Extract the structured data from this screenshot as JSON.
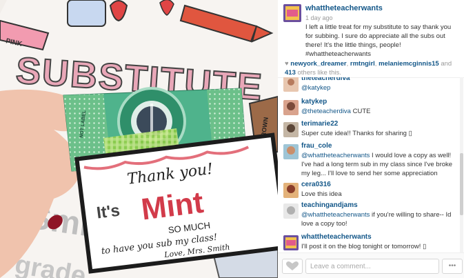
{
  "post": {
    "username": "whattheteacherwants",
    "time": "1 day ago",
    "caption": "I left a little treat for my substitute to say thank you for subbing. I sure do appreciate all the subs out there! It's the little things, people! #whattheteacherwants",
    "avatar_text": "What The Teacher Wants"
  },
  "likes": {
    "users": [
      "newyork_dreamer",
      "rmtngirl",
      "melaniemcginnis15"
    ],
    "and_word": "and",
    "count": "413",
    "suffix": "others like this."
  },
  "comments": [
    {
      "user": "theteacherdiva",
      "mention": "@katykep",
      "text": ""
    },
    {
      "user": "katykep",
      "mention": "@theteacherdiva",
      "text": " CUTE"
    },
    {
      "user": "terimarie22",
      "mention": "",
      "text": "Super cute idea!! Thanks for sharing ▯"
    },
    {
      "user": "frau_cole",
      "mention": "@whattheteacherwants",
      "text": " I would love a copy as well! I've had a long term sub in my class since I've broke my leg... I'll love to send her some appreciation"
    },
    {
      "user": "cera0316",
      "mention": "",
      "text": "Love this idea"
    },
    {
      "user": "teachingandjams",
      "mention": "@whattheteacherwants",
      "text": " if you're willing to share-- Id love a copy too!"
    },
    {
      "user": "whattheteacherwants",
      "mention": "",
      "text": "I'll post it on the blog tonight or tomorrow! ▯"
    }
  ],
  "footer": {
    "comment_placeholder": "Leave a comment...",
    "more_label": "•••"
  },
  "photo": {
    "poster_word": "SUBSTITUTE",
    "crayon_pink": "PINK",
    "crayon_brown": "BROWN",
    "card_line1": "Thank you!",
    "card_its": "It's",
    "card_mint": "Mint",
    "card_so_much": "SO MUCH",
    "card_line3": "to have you sub my class!",
    "card_sign": "Love, Mrs. Smith",
    "pack_label": "NOT LABEL",
    "bottom_word1": "Smith",
    "bottom_word2": "grade"
  },
  "colors": {
    "link": "#125688",
    "text": "#333333",
    "muted": "#9a9a9a",
    "mint_red": "#d23b4a",
    "mint_teal": "#3aa8a0",
    "mint_green": "#55b04a"
  }
}
